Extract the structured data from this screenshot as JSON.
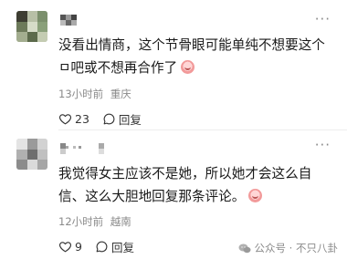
{
  "comments": [
    {
      "text": "没看出情商，这个节骨眼可能单纯不想要这个ㅁ吧或不想再合作了",
      "time": "13小时前",
      "location": "重庆",
      "likes": "23",
      "reply_label": "回复",
      "more_label": "···"
    },
    {
      "text": "我觉得女主应该不是她，所以她才会这么自信、这么大胆地回复那条评论。",
      "time": "12小时前",
      "location": "越南",
      "likes": "9",
      "reply_label": "回复",
      "more_label": "···"
    }
  ],
  "watermark": {
    "text": "公众号 · 不只八卦"
  },
  "colors": {
    "meta_text": "#8a8a8a",
    "body_text": "#191919"
  }
}
